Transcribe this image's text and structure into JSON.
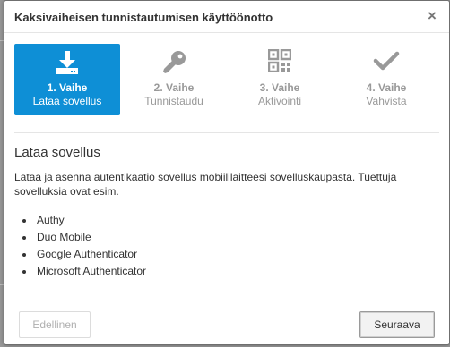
{
  "dialog": {
    "title": "Kaksivaiheisen tunnistautumisen käyttöönotto",
    "close_icon": "×"
  },
  "steps": [
    {
      "number": "1. Vaihe",
      "label": "Lataa sovellus",
      "icon": "download-icon",
      "active": true
    },
    {
      "number": "2. Vaihe",
      "label": "Tunnistaudu",
      "icon": "key-icon",
      "active": false
    },
    {
      "number": "3. Vaihe",
      "label": "Aktivointi",
      "icon": "qr-code-icon",
      "active": false
    },
    {
      "number": "4. Vaihe",
      "label": "Vahvista",
      "icon": "checkmark-icon",
      "active": false
    }
  ],
  "content": {
    "title": "Lataa sovellus",
    "description": "Lataa ja asenna autentikaatio sovellus mobiililaitteesi sovelluskaupasta. Tuettuja sovelluksia ovat esim.",
    "apps": [
      "Authy",
      "Duo Mobile",
      "Google Authenticator",
      "Microsoft Authenticator"
    ]
  },
  "footer": {
    "prev_label": "Edellinen",
    "next_label": "Seuraava"
  },
  "colors": {
    "accent": "#0e8fd6",
    "inactive_step": "#999999"
  }
}
